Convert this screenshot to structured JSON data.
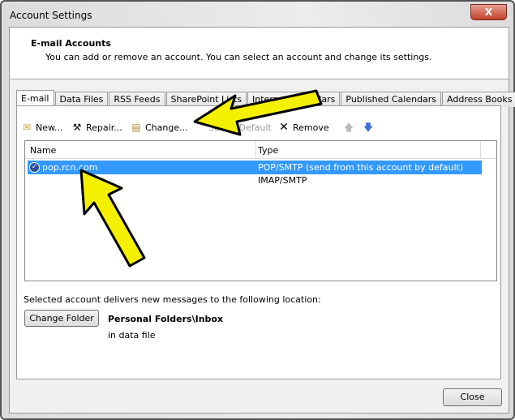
{
  "window": {
    "title": "Account Settings",
    "close_glyph": "X"
  },
  "header": {
    "title": "E-mail Accounts",
    "description": "You can add or remove an account. You can select an account and change its settings."
  },
  "tabs": [
    {
      "label": "E-mail",
      "active": true
    },
    {
      "label": "Data Files"
    },
    {
      "label": "RSS Feeds"
    },
    {
      "label": "SharePoint Lists"
    },
    {
      "label": "Internet Calendars"
    },
    {
      "label": "Published Calendars"
    },
    {
      "label": "Address Books"
    }
  ],
  "toolbar": {
    "new": "New...",
    "repair": "Repair...",
    "change": "Change...",
    "set_default": "Set as Default",
    "remove": "Remove",
    "up_icon": "arrow-up-icon",
    "down_icon": "arrow-down-icon"
  },
  "list": {
    "columns": [
      "Name",
      "Type"
    ],
    "rows": [
      {
        "name": "pop.rcn.com",
        "type": "POP/SMTP (send from this account by default)",
        "selected": true
      },
      {
        "name": "",
        "type": "IMAP/SMTP"
      }
    ]
  },
  "delivery": {
    "label": "Selected account delivers new messages to the following location:",
    "button": "Change Folder",
    "folder": "Personal Folders\\Inbox",
    "data_file": "in data file"
  },
  "footer": {
    "close": "Close"
  },
  "colors": {
    "selection": "#3399ff",
    "arrow": "#f5f000"
  }
}
